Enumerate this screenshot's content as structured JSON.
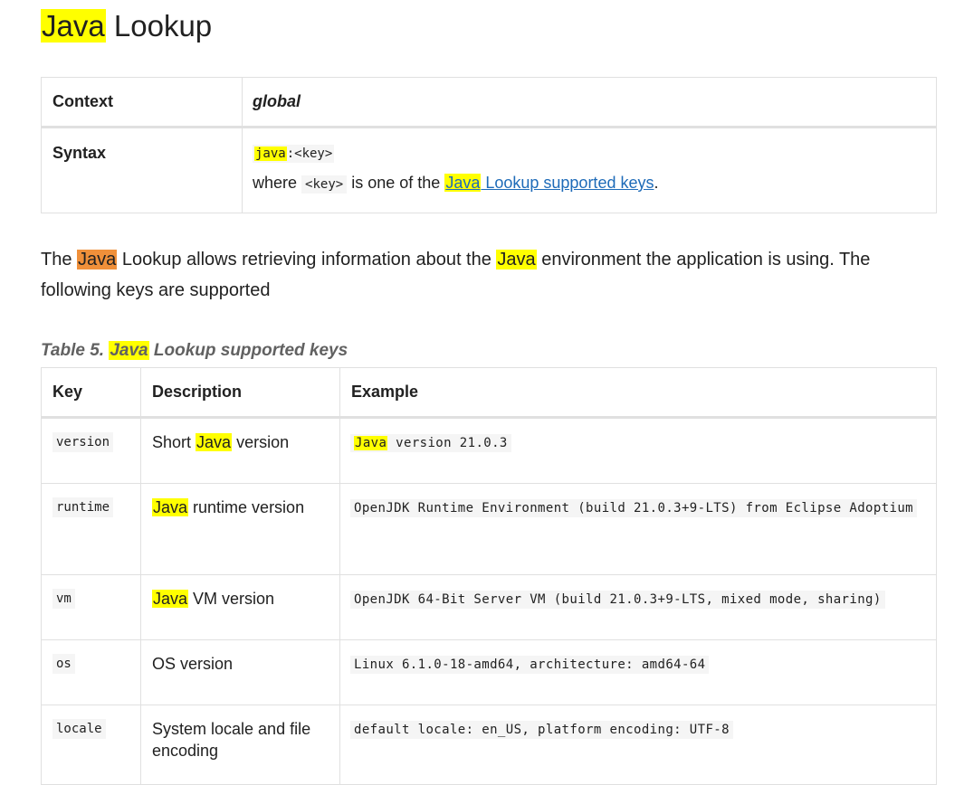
{
  "title": {
    "highlight": "Java",
    "rest": " Lookup"
  },
  "meta_table": {
    "context_label": "Context",
    "context_value": "global",
    "syntax_label": "Syntax",
    "syntax_prefix": "java",
    "syntax_suffix": ":<key>",
    "where_before": "where",
    "where_code": "<key>",
    "where_mid": "is one of the",
    "where_link_highlight": "Java",
    "where_link_rest": " Lookup supported keys",
    "where_end": "."
  },
  "intro": {
    "part1": "The ",
    "java1": "Java",
    "part2": " Lookup allows retrieving information about the ",
    "java2": "Java",
    "part3": " environment the application is using. The following keys are supported"
  },
  "caption": {
    "prefix": "Table 5. ",
    "highlight": "Java",
    "rest": " Lookup supported keys"
  },
  "keys_table": {
    "headers": [
      "Key",
      "Description",
      "Example"
    ],
    "rows": [
      {
        "key": "version",
        "desc_hl": "",
        "desc_before": "Short ",
        "desc_java": "Java",
        "desc_after": " version",
        "ex_java": "Java",
        "ex_rest": " version 21.0.3"
      },
      {
        "key": "runtime",
        "desc_java": "Java",
        "desc_after": " runtime version",
        "example": "OpenJDK Runtime Environment (build 21.0.3+9-LTS) from Eclipse Adoptium"
      },
      {
        "key": "vm",
        "desc_java": "Java",
        "desc_after": " VM version",
        "example": "OpenJDK 64-Bit Server VM (build 21.0.3+9-LTS, mixed mode, sharing)"
      },
      {
        "key": "os",
        "description": "OS version",
        "example": "Linux 6.1.0-18-amd64, architecture: amd64-64"
      },
      {
        "key": "locale",
        "description": "System locale and file encoding",
        "example": "default locale: en_US, platform encoding: UTF-8"
      }
    ]
  },
  "colors": {
    "highlight": "#ffff00",
    "current_highlight": "#f0903a",
    "link": "#1e6bb8",
    "border": "#e0e0e0"
  }
}
